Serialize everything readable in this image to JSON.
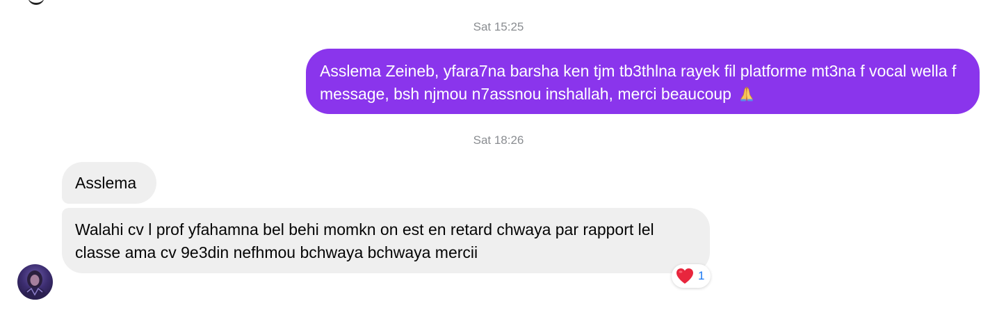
{
  "thread": {
    "timestamps": [
      "Sat 15:25",
      "Sat 18:26"
    ],
    "messages": [
      {
        "direction": "outgoing",
        "text": "Asslema Zeineb, yfara7na barsha ken tjm tb3thlna rayek fil platforme mt3na f vocal wella f message, bsh njmou n7assnou inshallah, merci beaucoup",
        "trailing_emoji": "folded-hands-icon"
      },
      {
        "direction": "incoming",
        "text": "Asslema"
      },
      {
        "direction": "incoming",
        "text": "Walahi cv l prof yfahamna bel behi momkn on est en retard chwaya par rapport lel classe ama cv 9e3din nefhmou bchwaya bchwaya mercii",
        "reaction": {
          "icon": "red-heart-icon",
          "count": "1"
        }
      }
    ]
  },
  "colors": {
    "outgoing_bubble": "#8a35ec",
    "incoming_bubble": "#efefef",
    "timestamp_text": "#8a8d91",
    "reaction_count": "#1877f2"
  }
}
